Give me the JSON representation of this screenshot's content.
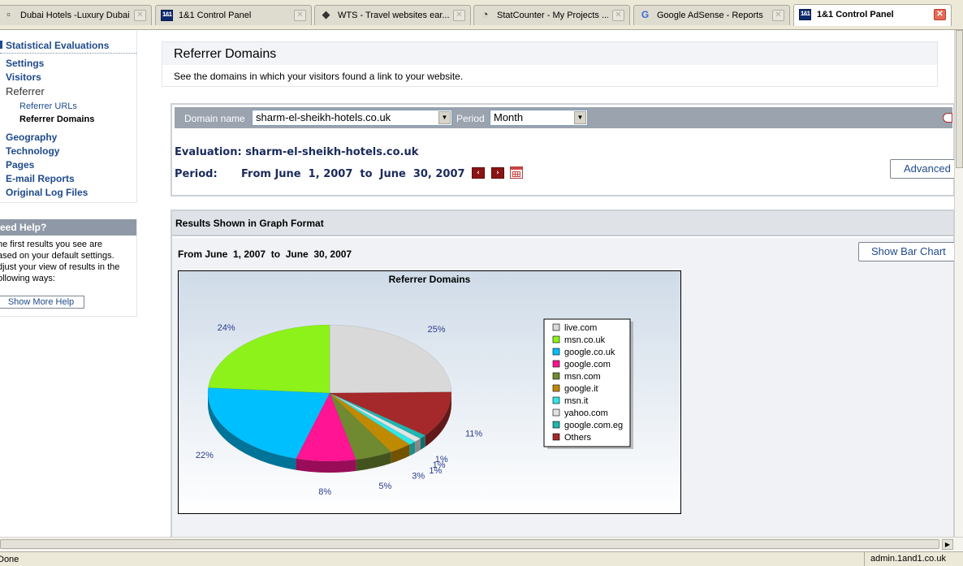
{
  "tabs": [
    {
      "label": "Dubai Hotels -Luxury Dubai...",
      "icon": "document-icon",
      "active": false
    },
    {
      "label": "1&1 Control Panel",
      "icon": "1and1-icon",
      "active": false
    },
    {
      "label": "WTS - Travel websites ear...",
      "icon": "wts-icon",
      "active": false
    },
    {
      "label": "StatCounter - My Projects ...",
      "icon": "statcounter-icon",
      "active": false
    },
    {
      "label": "Google AdSense - Reports",
      "icon": "google-icon",
      "active": false
    },
    {
      "label": "1&1 Control Panel",
      "icon": "1and1-icon",
      "active": true
    }
  ],
  "tab_icon_text": {
    "brand": "1&1",
    "google": "G",
    "wts": "◆",
    "statcounter": "◔",
    "doc": "▫",
    "close": "✕"
  },
  "sidebar": {
    "section_title": "Statistical Evaluations",
    "items": [
      {
        "label": "Settings"
      },
      {
        "label": "Visitors"
      },
      {
        "label": "Referrer"
      },
      {
        "label": "Referrer URLs"
      },
      {
        "label": "Referrer Domains"
      },
      {
        "label": "Geography"
      },
      {
        "label": "Technology"
      },
      {
        "label": "Pages"
      },
      {
        "label": "E-mail Reports"
      },
      {
        "label": "Original Log Files"
      }
    ],
    "help": {
      "title": "eed Help?",
      "lines": [
        "he first results you see are",
        "ased on your default settings.",
        "djust your view of results in the",
        "ollowing ways:"
      ],
      "button": "Show More Help"
    }
  },
  "main": {
    "title": "Referrer Domains",
    "description": "See the domains in which your visitors found a link to your website.",
    "filter": {
      "domain_label": "Domain name",
      "domain_value": "sharm-el-sheikh-hotels.co.uk",
      "period_label": "Period",
      "period_value": "Month",
      "evaluation": "Evaluation: sharm-el-sheikh-hotels.co.uk",
      "period_caption": "Period:",
      "period_range": "From June  1, 2007  to  June  30, 2007",
      "advanced_label": "Advanced"
    },
    "results": {
      "title": "Results Shown in Graph Format",
      "range": "From June  1, 2007  to  June  30, 2007",
      "bar_chart_button": "Show Bar Chart"
    }
  },
  "chart_data": {
    "type": "pie",
    "title": "Referrer Domains",
    "series": [
      {
        "name": "live.com",
        "value": 25,
        "label": "25%",
        "color": "#d9d9d9"
      },
      {
        "name": "Others",
        "value": 11,
        "label": "11%",
        "color": "#a5292a"
      },
      {
        "name": "google.com.eg",
        "value": 1,
        "label": "1%",
        "color": "#1fb5b0"
      },
      {
        "name": "yahoo.com",
        "value": 1,
        "label": "1%",
        "color": "#e3e3e3"
      },
      {
        "name": "msn.it",
        "value": 1,
        "label": "1%",
        "color": "#33e6e6"
      },
      {
        "name": "google.it",
        "value": 3,
        "label": "3%",
        "color": "#c08a00"
      },
      {
        "name": "msn.com",
        "value": 5,
        "label": "5%",
        "color": "#6f8a30"
      },
      {
        "name": "google.com",
        "value": 8,
        "label": "8%",
        "color": "#ff1493"
      },
      {
        "name": "google.co.uk",
        "value": 22,
        "label": "22%",
        "color": "#00bfff"
      },
      {
        "name": "msn.co.uk",
        "value": 24,
        "label": "24%",
        "color": "#8cf21a"
      }
    ],
    "legend": [
      "live.com",
      "msn.co.uk",
      "google.co.uk",
      "google.com",
      "msn.com",
      "google.it",
      "msn.it",
      "yahoo.com",
      "google.com.eg",
      "Others"
    ],
    "legend_position": "right"
  },
  "status": {
    "left": "Done",
    "right": "admin.1and1.co.uk"
  }
}
